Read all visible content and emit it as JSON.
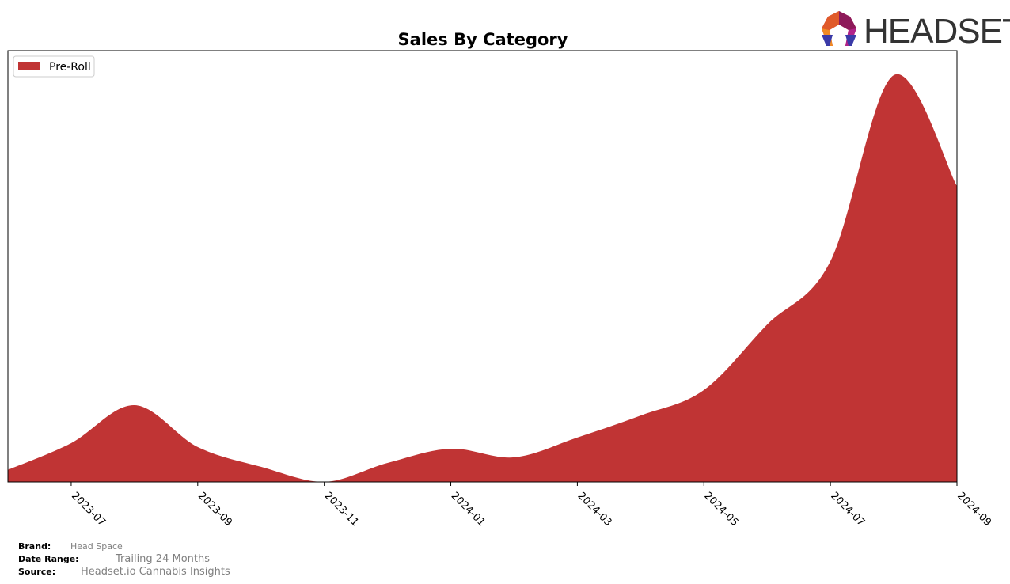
{
  "brand_logo": {
    "text": "HEADSET",
    "icon": "headset-hexagon-logo-icon"
  },
  "chart_data": {
    "type": "area",
    "title": "Sales By Category",
    "xlabel": "",
    "ylabel": "",
    "x": [
      "2023-06",
      "2023-07",
      "2023-08",
      "2023-09",
      "2023-10",
      "2023-11",
      "2023-12",
      "2024-01",
      "2024-02",
      "2024-03",
      "2024-04",
      "2024-05",
      "2024-06",
      "2024-07",
      "2024-08",
      "2024-09"
    ],
    "x_tick_labels": [
      "2023-07",
      "2023-09",
      "2023-11",
      "2024-01",
      "2024-03",
      "2024-05",
      "2024-07",
      "2024-09"
    ],
    "series": [
      {
        "name": "Pre-Roll",
        "color": "#c03434",
        "values": [
          2.8,
          9.0,
          17.8,
          8.1,
          3.5,
          0.0,
          4.4,
          7.7,
          5.7,
          10.3,
          15.4,
          21.3,
          36.5,
          51.2,
          94.3,
          68.6
        ]
      }
    ],
    "ylim": [
      0,
      100
    ],
    "y_ticks_visible": false,
    "grid": false,
    "legend_position": "top-left",
    "smoothed": true
  },
  "footer": {
    "brand_label": "Brand:",
    "brand_value": "Head Space",
    "date_range_label": "Date Range:",
    "date_range_value": "Trailing 24 Months",
    "source_label": "Source:",
    "source_value": "Headset.io Cannabis Insights"
  }
}
